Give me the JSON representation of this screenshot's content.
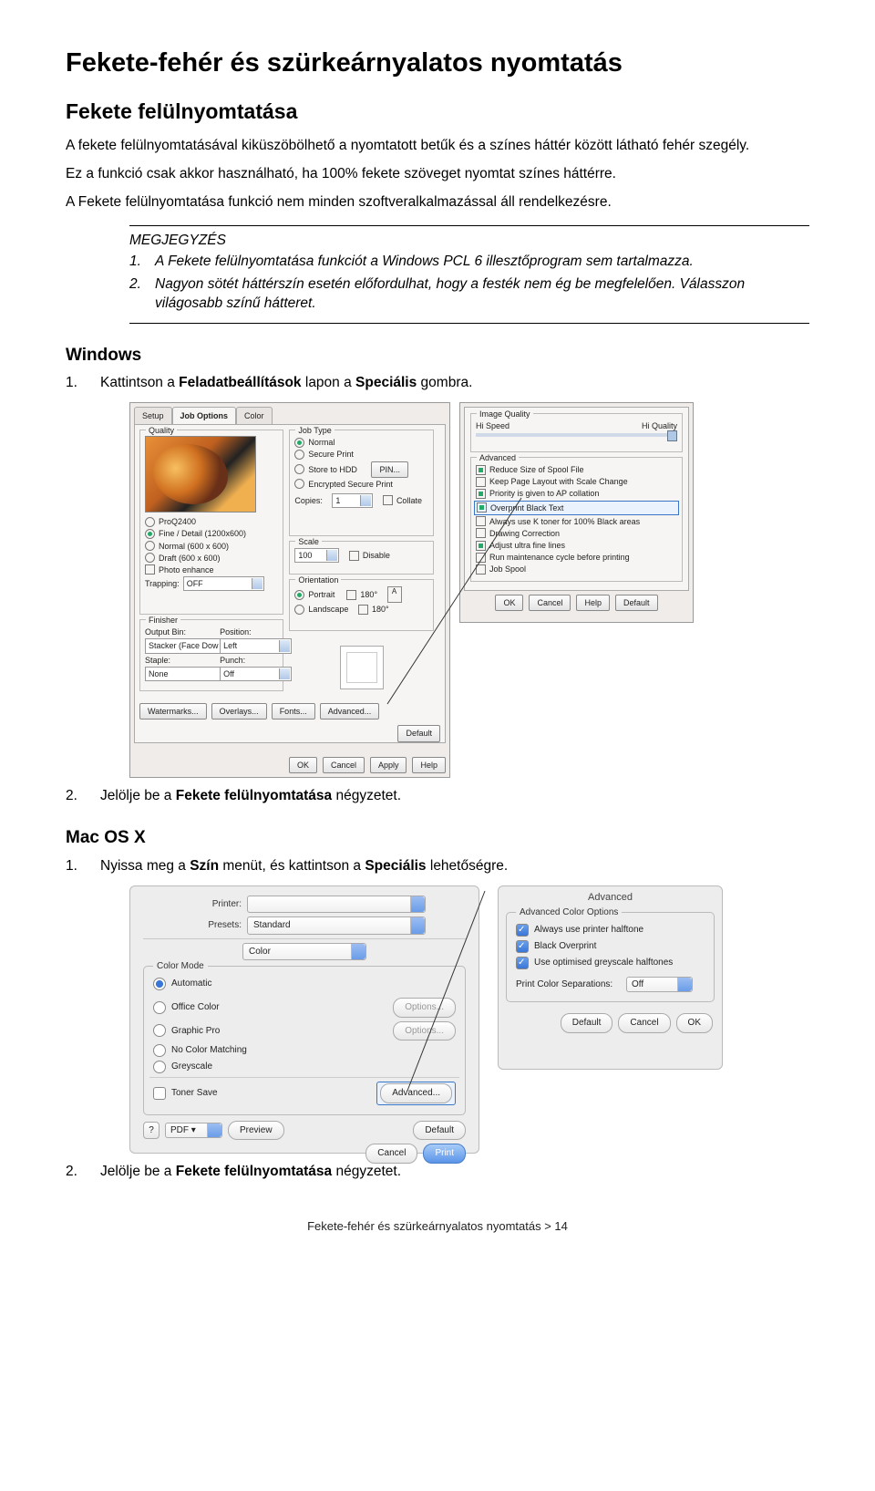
{
  "title": "Fekete-fehér és szürkeárnyalatos nyomtatás",
  "subtitle": "Fekete felülnyomtatása",
  "intro1": "A fekete felülnyomtatásával kiküszöbölhető a nyomtatott betűk és a színes háttér között látható fehér szegély.",
  "intro2": "Ez a funkció csak akkor használható, ha 100% fekete szöveget nyomtat színes háttérre.",
  "intro3": "A Fekete felülnyomtatása funkció nem minden szoftveralkalmazással áll rendelkezésre.",
  "note_label": "MEGJEGYZÉS",
  "notes": {
    "n1": "A Fekete felülnyomtatása funkciót a Windows PCL 6 illesztőprogram sem tartalmazza.",
    "n2": "Nagyon sötét háttérszín esetén előfordulhat, hogy a festék nem ég be megfelelően. Válasszon világosabb színű hátteret."
  },
  "windows_h": "Windows",
  "win_step1_pre": "Kattintson a ",
  "win_step1_b1": "Feladatbeállítások",
  "win_step1_mid": " lapon a ",
  "win_step1_b2": "Speciális",
  "win_step1_post": " gombra.",
  "win_step2_pre": "Jelölje be a ",
  "win_step2_b": "Fekete felülnyomtatása",
  "win_step2_post": " négyzetet.",
  "mac_h": "Mac OS X",
  "mac_step1_pre": "Nyissa meg a ",
  "mac_step1_b1": "Szín",
  "mac_step1_mid": " menüt, és kattintson a ",
  "mac_step1_b2": "Speciális",
  "mac_step1_post": " lehetőségre.",
  "mac_step2_pre": "Jelölje be a ",
  "mac_step2_b": "Fekete felülnyomtatása",
  "mac_step2_post": " négyzetet.",
  "footer": "Fekete-fehér és szürkeárnyalatos nyomtatás > 14",
  "dlg1": {
    "tabs": {
      "setup": "Setup",
      "job": "Job Options",
      "color": "Color"
    },
    "quality": {
      "title": "Quality",
      "proq": "ProQ2400",
      "fine": "Fine / Detail (1200x600)",
      "normal": "Normal (600 x 600)",
      "draft": "Draft (600 x 600)",
      "photo": "Photo enhance",
      "trapping": "Trapping:",
      "off": "OFF"
    },
    "jobtype": {
      "title": "Job Type",
      "normal": "Normal",
      "secure": "Secure Print",
      "store": "Store to HDD",
      "enc": "Encrypted Secure Print",
      "pin": "PIN...",
      "copies": "Copies:",
      "one": "1",
      "collate": "Collate"
    },
    "scale": {
      "title": "Scale",
      "v": "100",
      "disable": "Disable"
    },
    "orient": {
      "title": "Orientation",
      "portrait": "Portrait",
      "landscape": "Landscape",
      "r180a": "180°",
      "r180b": "180°"
    },
    "fin": {
      "title": "Finisher",
      "output": "Output Bin:",
      "outv": "Stacker (Face Dow",
      "staple": "Staple:",
      "staplev": "None",
      "pos": "Position:",
      "posv": "Left",
      "punch": "Punch:",
      "punchv": "Off"
    },
    "btns": {
      "wm": "Watermarks...",
      "ov": "Overlays...",
      "fonts": "Fonts...",
      "adv": "Advanced...",
      "def": "Default",
      "ok": "OK",
      "cancel": "Cancel",
      "apply": "Apply",
      "help": "Help"
    }
  },
  "dlg2": {
    "iq": {
      "title": "Image Quality",
      "hs": "Hi Speed",
      "hq": "Hi Quality"
    },
    "adv": {
      "title": "Advanced",
      "reduce": "Reduce Size of Spool File",
      "keep": "Keep Page Layout with Scale Change",
      "prio": "Priority is given to AP collation",
      "over": "Overprint Black Text",
      "ktoner": "Always use K toner for 100% Black areas",
      "draw": "Drawing Correction",
      "ultra": "Adjust ultra fine lines",
      "maint": "Run maintenance cycle before printing",
      "spool": "Job Spool"
    },
    "btns": {
      "ok": "OK",
      "cancel": "Cancel",
      "help": "Help",
      "def": "Default"
    }
  },
  "mac1": {
    "printer": "Printer:",
    "presets": "Presets:",
    "standard": "Standard",
    "menu": "Color",
    "cm": {
      "title": "Color Mode",
      "auto": "Automatic",
      "office": "Office Color",
      "graphic": "Graphic Pro",
      "nomatch": "No Color Matching",
      "grey": "Greyscale",
      "options": "Options..."
    },
    "toner": "Toner Save",
    "adv": "Advanced...",
    "btns": {
      "pdf": "PDF ▾",
      "preview": "Preview",
      "cancel": "Cancel",
      "print": "Print",
      "help": "?",
      "def": "Default"
    }
  },
  "mac2": {
    "title": "Advanced",
    "grp": "Advanced Color Options",
    "half": "Always use printer halftone",
    "black": "Black Overprint",
    "opt": "Use optimised greyscale halftones",
    "sep": "Print Color Separations:",
    "off": "Off",
    "btns": {
      "def": "Default",
      "cancel": "Cancel",
      "ok": "OK"
    }
  }
}
